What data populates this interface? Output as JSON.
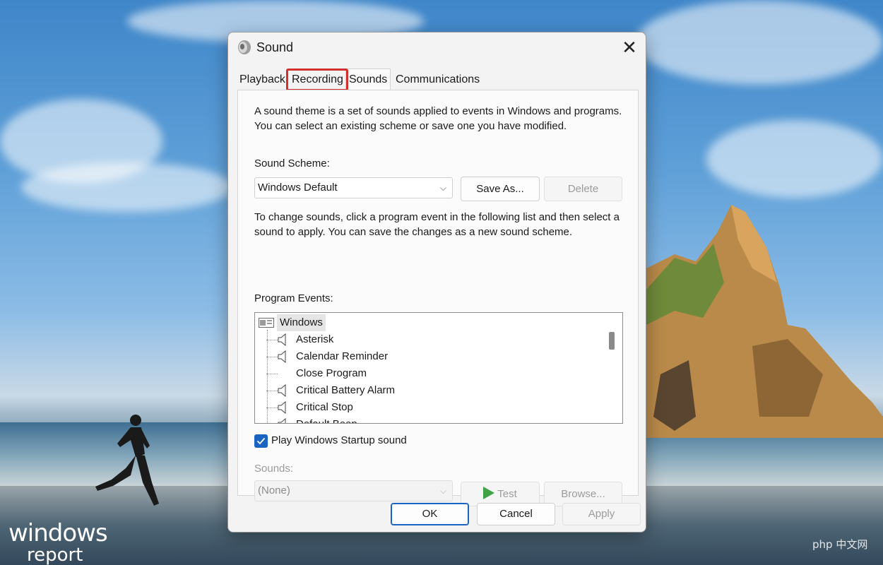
{
  "dialog": {
    "title": "Sound",
    "close_glyph": "✕",
    "tabs": [
      {
        "label": "Playback"
      },
      {
        "label": "Recording"
      },
      {
        "label": "Sounds"
      },
      {
        "label": "Communications"
      }
    ],
    "active_tab": "Sounds",
    "highlighted_tab": "Recording",
    "description": "A sound theme is a set of sounds applied to events in Windows and programs.  You can select an existing scheme or save one you have modified.",
    "scheme_label": "Sound Scheme:",
    "scheme_value": "Windows Default",
    "save_as_label": "Save As...",
    "delete_label": "Delete",
    "instructions": "To change sounds, click a program event in the following list and then select a sound to apply.  You can save the changes as a new sound scheme.",
    "events_label": "Program Events:",
    "events": {
      "group": "Windows",
      "items": [
        {
          "label": "Asterisk",
          "icon": "speaker-icon"
        },
        {
          "label": "Calendar Reminder",
          "icon": "speaker-icon"
        },
        {
          "label": "Close Program",
          "icon": ""
        },
        {
          "label": "Critical Battery Alarm",
          "icon": "speaker-icon"
        },
        {
          "label": "Critical Stop",
          "icon": "speaker-icon"
        },
        {
          "label": "Default Beep",
          "icon": "speaker-icon"
        }
      ]
    },
    "startup_sound_label": "Play Windows Startup sound",
    "startup_sound_checked": true,
    "sounds_label": "Sounds:",
    "sounds_value": "(None)",
    "test_label": "Test",
    "browse_label": "Browse...",
    "ok_label": "OK",
    "cancel_label": "Cancel",
    "apply_label": "Apply"
  },
  "desktop": {
    "brand_top": "windows",
    "brand_bottom": "report",
    "watermark": "php 中文网"
  },
  "colors": {
    "accent": "#1b63c0",
    "highlight_box": "#d0312d",
    "test_play": "#3fa245"
  }
}
